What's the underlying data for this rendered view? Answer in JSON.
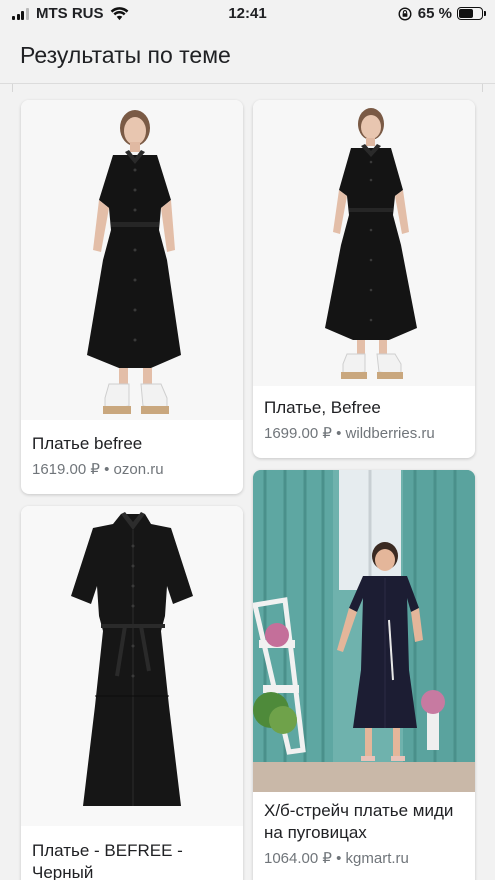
{
  "status": {
    "carrier": "MTS RUS",
    "time": "12:41",
    "battery_pct": "65 %",
    "battery_level": 0.65
  },
  "header": {
    "title": "Результаты по теме"
  },
  "results": [
    {
      "title": "Платье befree",
      "price": "1619.00 ₽",
      "source": "ozon.ru"
    },
    {
      "title": "Платье, Befree",
      "price": "1699.00 ₽",
      "source": "wildberries.ru"
    },
    {
      "title": "Платье - BEFREE - Черный",
      "price": "",
      "source": ""
    },
    {
      "title": "Х/б-стрейч платье миди на пуговицах",
      "price": "1064.00 ₽",
      "source": "kgmart.ru"
    }
  ],
  "separator": "•"
}
